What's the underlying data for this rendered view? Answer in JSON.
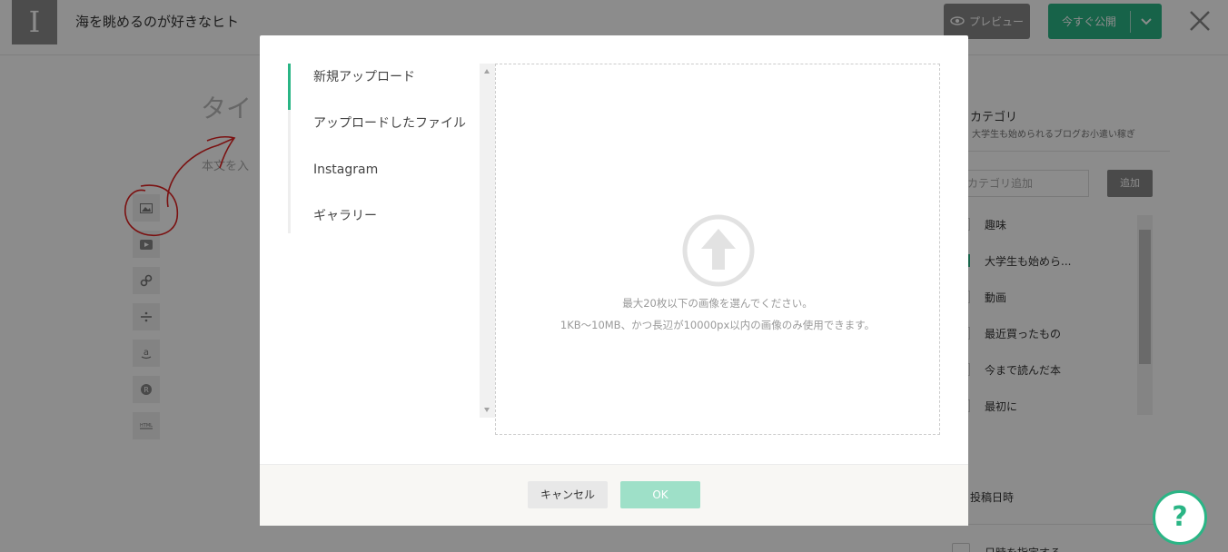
{
  "header": {
    "logo_letter": "I",
    "blog_title": "海を眺めるのが好きなヒト",
    "preview_label": "プレビュー",
    "publish_label": "今すぐ公開"
  },
  "editor": {
    "title_placeholder": "タイ",
    "body_placeholder": "本文を入",
    "toolbar_icons": [
      "image-icon",
      "video-icon",
      "link-icon",
      "divider-icon",
      "amazon-icon",
      "rakuten-icon",
      "html-icon"
    ]
  },
  "sidebar": {
    "category_title": "カテゴリ",
    "category_desc": "大学生も始められるブログお小遣い稼ぎ",
    "category_input_placeholder": "カテゴリ追加",
    "add_label": "追加",
    "categories": [
      {
        "label": "趣味",
        "checked": false
      },
      {
        "label": "大学生も始めら...",
        "checked": true
      },
      {
        "label": "動画",
        "checked": false
      },
      {
        "label": "最近買ったもの",
        "checked": false
      },
      {
        "label": "今まで読んだ本",
        "checked": false
      },
      {
        "label": "最初に",
        "checked": false
      }
    ],
    "post_date_title": "投稿日時",
    "date_option": "日時を指定する"
  },
  "help": {
    "label": "?"
  },
  "modal": {
    "nav": [
      "新規アップロード",
      "アップロードしたファイル",
      "Instagram",
      "ギャラリー"
    ],
    "active_nav": "新規アップロード",
    "dropzone_line1": "最大20枚以下の画像を選んでください。",
    "dropzone_line2": "1KB〜10MB、かつ長辺が10000px以内の画像のみ使用できます。",
    "cancel_label": "キャンセル",
    "ok_label": "OK"
  },
  "colors": {
    "accent": "#2ab585",
    "ok_disabled": "#9ee0c8",
    "annotation": "#e02020"
  }
}
